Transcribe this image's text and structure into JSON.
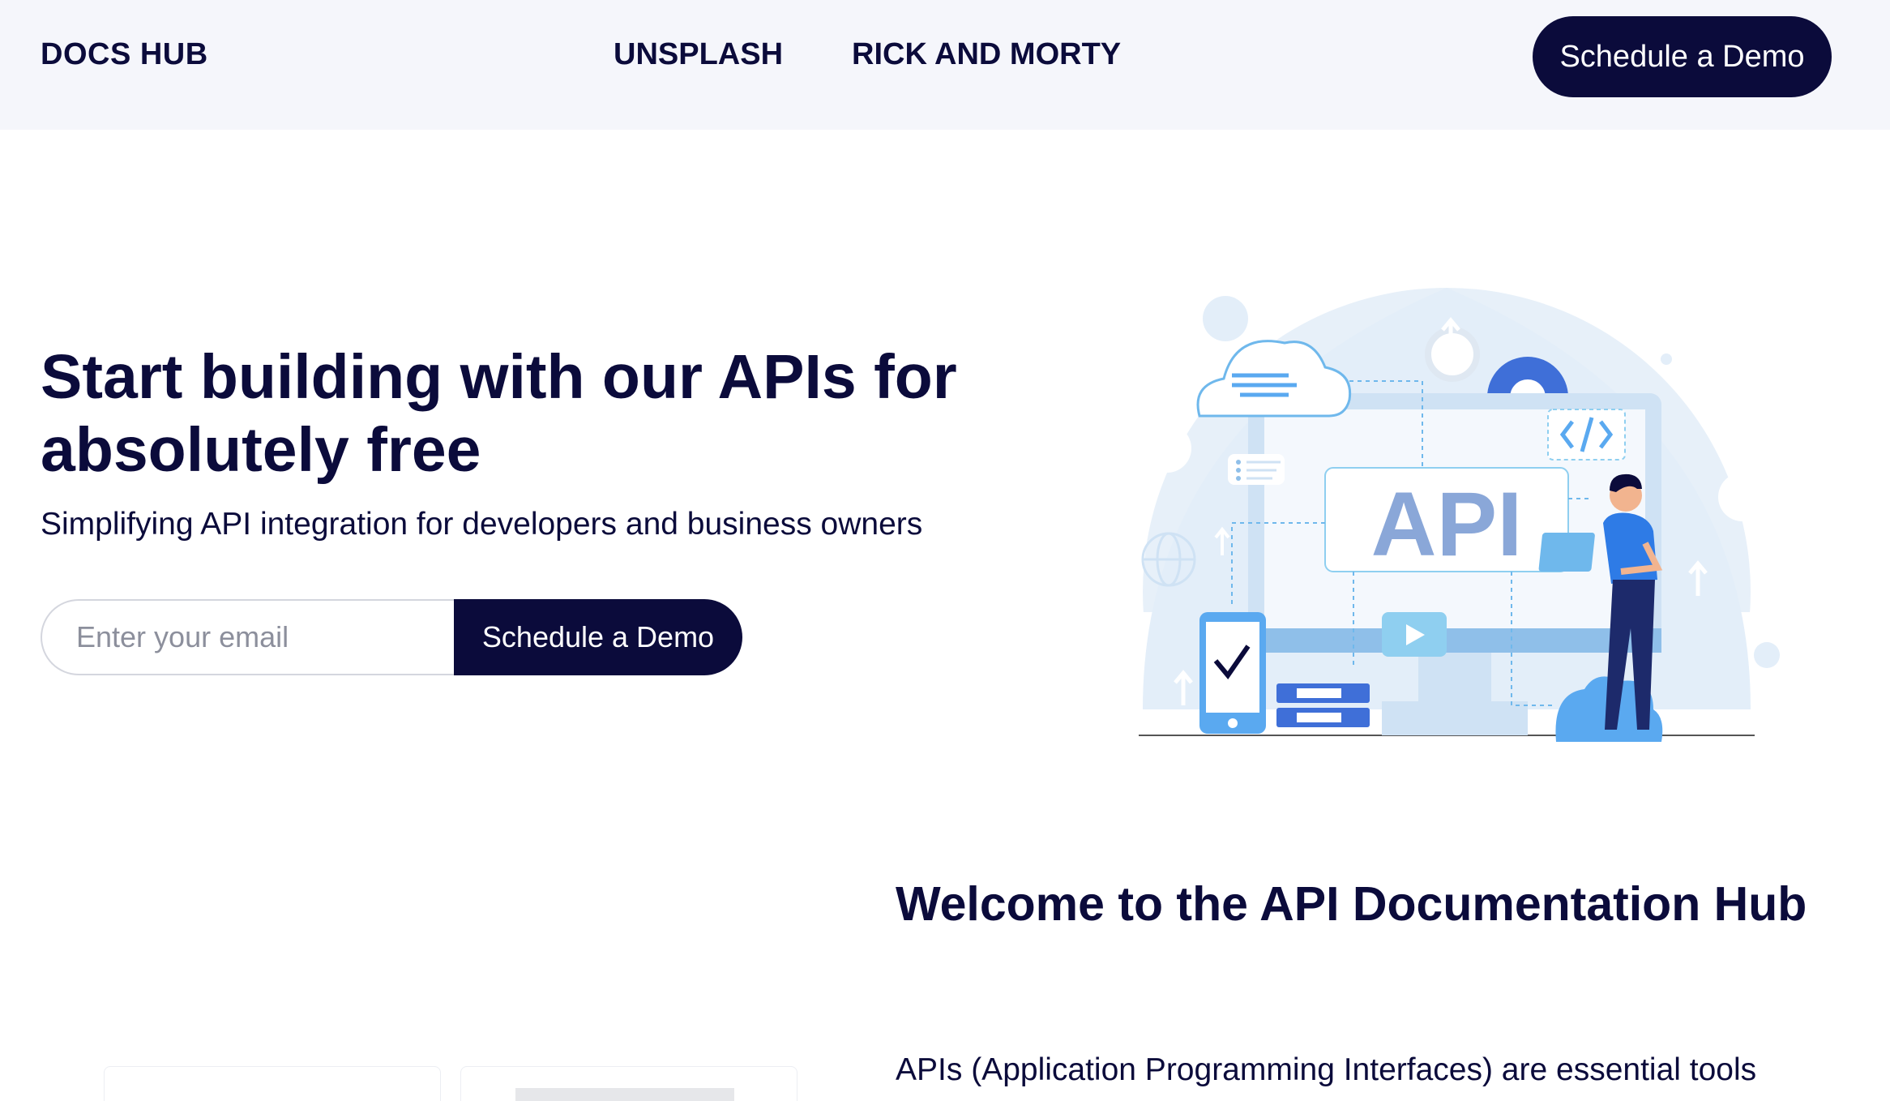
{
  "nav": {
    "logo": "DOCS HUB",
    "links": [
      {
        "label": "UNSPLASH"
      },
      {
        "label": "RICK AND MORTY"
      }
    ],
    "cta_label": "Schedule a Demo"
  },
  "hero": {
    "title": "Start building with our APIs for absolutely free",
    "subtitle": "Simplifying API integration for developers and business owners",
    "email_placeholder": "Enter your email",
    "cta_label": "Schedule a Demo",
    "illustration_label": "API"
  },
  "welcome": {
    "title": "Welcome to the API Documentation Hub",
    "intro": "APIs (Application Programming Interfaces) are essential tools"
  },
  "colors": {
    "navy": "#0b0b3b",
    "nav_bg": "#f5f6fb",
    "illustration_blue": "#5aa9f0",
    "illustration_light": "#e3eef9"
  }
}
